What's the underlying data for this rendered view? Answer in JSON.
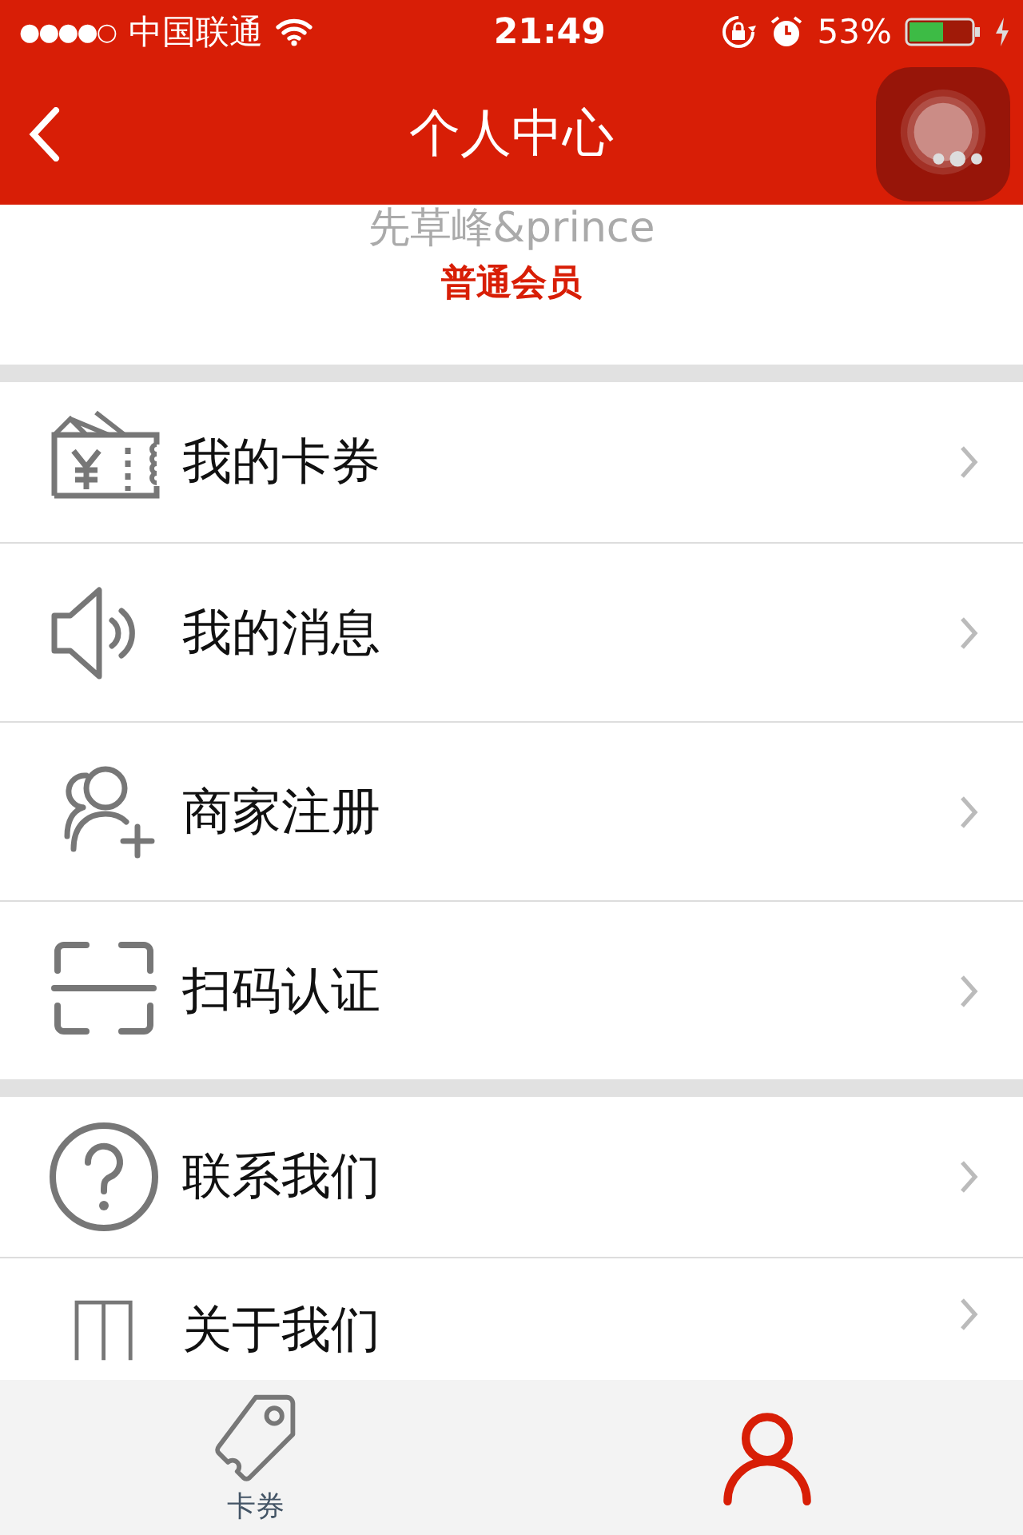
{
  "status_bar": {
    "signal": "●●●●○",
    "carrier": "中国联通",
    "time": "21:49",
    "battery": "53%"
  },
  "nav": {
    "title": "个人中心"
  },
  "profile": {
    "name": "先草峰&prince",
    "membership": "普通会员"
  },
  "sections": [
    {
      "items": [
        {
          "kind": "coupon",
          "label": "我的卡券"
        },
        {
          "kind": "speaker",
          "label": "我的消息"
        },
        {
          "kind": "merchant",
          "label": "商家注册"
        },
        {
          "kind": "scan",
          "label": "扫码认证"
        }
      ]
    },
    {
      "items": [
        {
          "kind": "help",
          "label": "联系我们"
        },
        {
          "kind": "book",
          "label": "关于我们"
        }
      ]
    }
  ],
  "tab_bar": [
    {
      "kind": "tag",
      "label": "卡券",
      "selected": false
    },
    {
      "kind": "person",
      "selected": true
    }
  ]
}
